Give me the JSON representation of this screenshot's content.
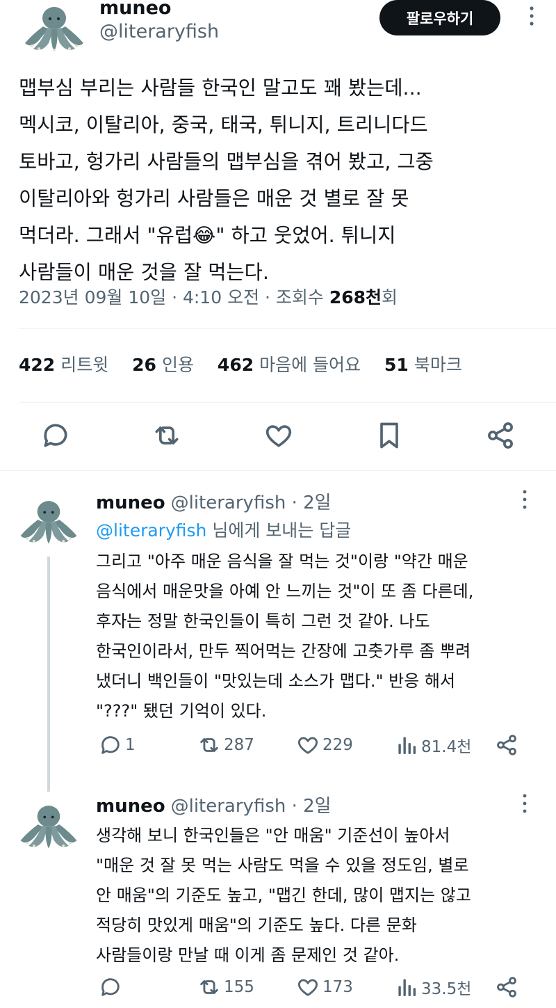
{
  "main_tweet": {
    "author_name": "muneo",
    "author_handle": "@literaryfish",
    "follow_label": "팔로우하기",
    "text": "맵부심 부리는 사람들 한국인 말고도 꽤 봤는데...\n멕시코, 이탈리아, 중국, 태국, 튀니지, 트리니다드\n토바고, 헝가리 사람들의 맵부심을 겪어 봤고, 그중\n이탈리아와 헝가리 사람들은 매운 것 별로 잘 못\n먹더라. 그래서 \"유럽😂\" 하고 웃었어. 튀니지\n사람들이 매운 것을 잘 먹는다.",
    "date": "2023년 09월 10일 · 4:10 오전 · 조회수 ",
    "views": "268천",
    "views_suffix": "회",
    "stats": {
      "retweets_num": "422",
      "retweets_label": "리트윗",
      "quotes_num": "26",
      "quotes_label": "인용",
      "likes_num": "462",
      "likes_label": "마음에 들어요",
      "bookmarks_num": "51",
      "bookmarks_label": "북마크"
    }
  },
  "replies": [
    {
      "author_name": "muneo",
      "author_handle": "@literaryfish · 2일",
      "reply_to_handle": "@literaryfish",
      "reply_to_suffix": " 님에게 보내는 답글",
      "text": "그리고 \"아주 매운 음식을 잘 먹는 것\"이랑 \"약간 매운\n음식에서 매운맛을 아예 안 느끼는 것\"이 또 좀 다른데,\n후자는 정말 한국인들이 특히 그런 것 같아. 나도\n한국인이라서, 만두 찍어먹는 간장에 고춧가루 좀 뿌려\n냈더니 백인들이 \"맛있는데 소스가 맵다.\" 반응 해서\n\"???\" 됐던 기억이 있다.",
      "replies": "1",
      "retweets": "287",
      "likes": "229",
      "views": "81.4천"
    },
    {
      "author_name": "muneo",
      "author_handle": "@literaryfish · 2일",
      "text": "생각해 보니 한국인들은 \"안 매움\" 기준선이 높아서\n\"매운 것 잘 못 먹는 사람도 먹을 수 있을 정도임, 별로\n안 매움\"의 기준도 높고, \"맵긴 한데, 많이 맵지는 않고\n적당히 맛있게 매움\"의 기준도 높다. 다른 문화\n사람들이랑 만날 때 이게 좀 문제인 것 같아.",
      "replies": "",
      "retweets": "155",
      "likes": "173",
      "views": "33.5천"
    }
  ],
  "colors": {
    "text": "#0f1419",
    "muted": "#536471",
    "link": "#1d9bf0",
    "divider": "#eff3f4",
    "avatar": "#6d8a8c"
  }
}
